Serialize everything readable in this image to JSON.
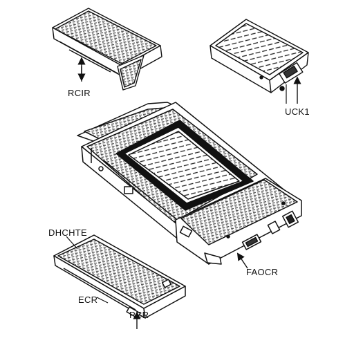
{
  "diagram": {
    "labels": {
      "rcir": "RCIR",
      "uck1": "UCK1",
      "dhchte": "DHCHTE",
      "faocr": "FAOCR",
      "ecr": "ECR",
      "pcr": "PCR"
    },
    "components": [
      "top-left-cartridge",
      "top-right-module",
      "main-device",
      "bottom-left-cartridge"
    ]
  }
}
